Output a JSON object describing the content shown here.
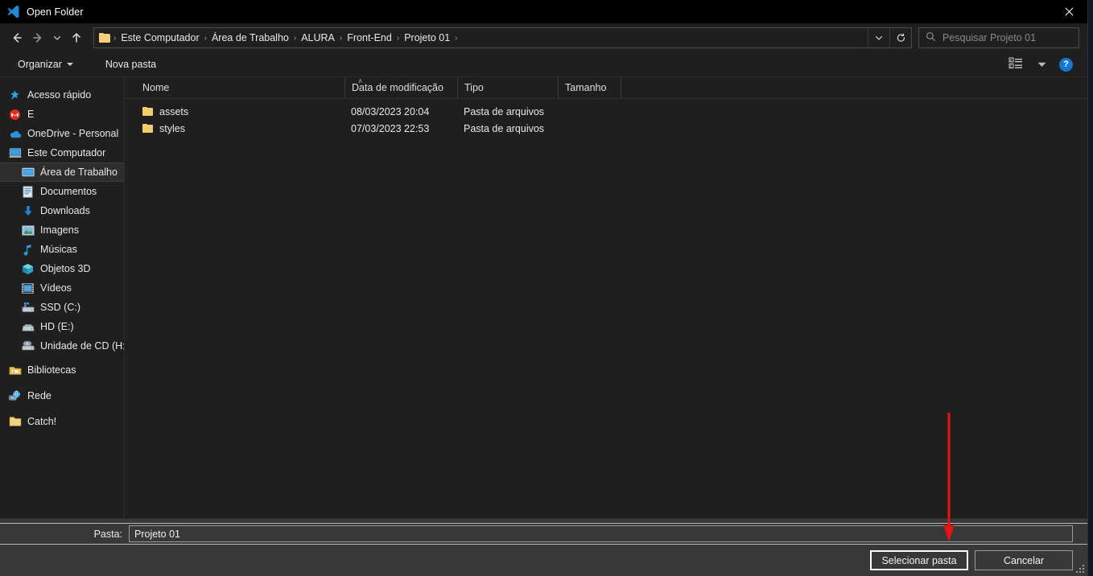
{
  "window": {
    "title": "Open Folder",
    "app_icon": "vscode-icon",
    "close_label": "✕"
  },
  "nav": {
    "back_title": "Voltar",
    "forward_title": "Avançar",
    "recent_title": "Locais recentes",
    "up_title": "Acima",
    "refresh_title": "Atualizar",
    "breadcrumbs": [
      "Este Computador",
      "Área de Trabalho",
      "ALURA",
      "Front-End",
      "Projeto 01"
    ],
    "separator": "›"
  },
  "search": {
    "placeholder": "Pesquisar Projeto 01",
    "icon": "search-icon"
  },
  "toolbar": {
    "organize_label": "Organizar",
    "new_folder_label": "Nova pasta",
    "view_icon": "view-options-icon",
    "help_label": "?"
  },
  "sidebar": {
    "items": [
      {
        "label": "Acesso rápido",
        "icon": "star-pin-icon",
        "indent": false,
        "selected": false
      },
      {
        "label": "E",
        "icon": "gmail-icon",
        "indent": false,
        "selected": false
      },
      {
        "label": "OneDrive - Personal",
        "icon": "onedrive-cloud-icon",
        "indent": false,
        "selected": false
      },
      {
        "label": "Este Computador",
        "icon": "this-pc-icon",
        "indent": false,
        "selected": false
      },
      {
        "label": "Área de Trabalho",
        "icon": "desktop-icon",
        "indent": true,
        "selected": true
      },
      {
        "label": "Documentos",
        "icon": "documents-icon",
        "indent": true,
        "selected": false
      },
      {
        "label": "Downloads",
        "icon": "downloads-arrow-icon",
        "indent": true,
        "selected": false
      },
      {
        "label": "Imagens",
        "icon": "pictures-icon",
        "indent": true,
        "selected": false
      },
      {
        "label": "Músicas",
        "icon": "music-note-icon",
        "indent": true,
        "selected": false
      },
      {
        "label": "Objetos 3D",
        "icon": "3d-objects-icon",
        "indent": true,
        "selected": false
      },
      {
        "label": "Vídeos",
        "icon": "videos-icon",
        "indent": true,
        "selected": false
      },
      {
        "label": "SSD (C:)",
        "icon": "ssd-drive-icon",
        "indent": true,
        "selected": false
      },
      {
        "label": "HD (E:)",
        "icon": "hard-drive-icon",
        "indent": true,
        "selected": false
      },
      {
        "label": "Unidade de CD (H:",
        "icon": "cd-drive-icon",
        "indent": true,
        "selected": false
      },
      {
        "label": "Bibliotecas",
        "icon": "libraries-icon",
        "indent": false,
        "selected": false
      },
      {
        "label": "Rede",
        "icon": "network-icon",
        "indent": false,
        "selected": false
      },
      {
        "label": "Catch!",
        "icon": "folder-icon",
        "indent": false,
        "selected": false
      }
    ]
  },
  "filelist": {
    "columns": [
      "Nome",
      "Data de modificação",
      "Tipo",
      "Tamanho"
    ],
    "sort_indicator": "˄",
    "rows": [
      {
        "name": "assets",
        "modified": "08/03/2023 20:04",
        "type": "Pasta de arquivos",
        "size": ""
      },
      {
        "name": "styles",
        "modified": "07/03/2023 22:53",
        "type": "Pasta de arquivos",
        "size": ""
      }
    ]
  },
  "footer": {
    "folder_label": "Pasta:",
    "folder_value": "Projeto 01",
    "select_button": "Selecionar pasta",
    "cancel_button": "Cancelar"
  },
  "annotation": {
    "arrow_color": "#ee1111",
    "points_to": "Selecionar pasta"
  }
}
